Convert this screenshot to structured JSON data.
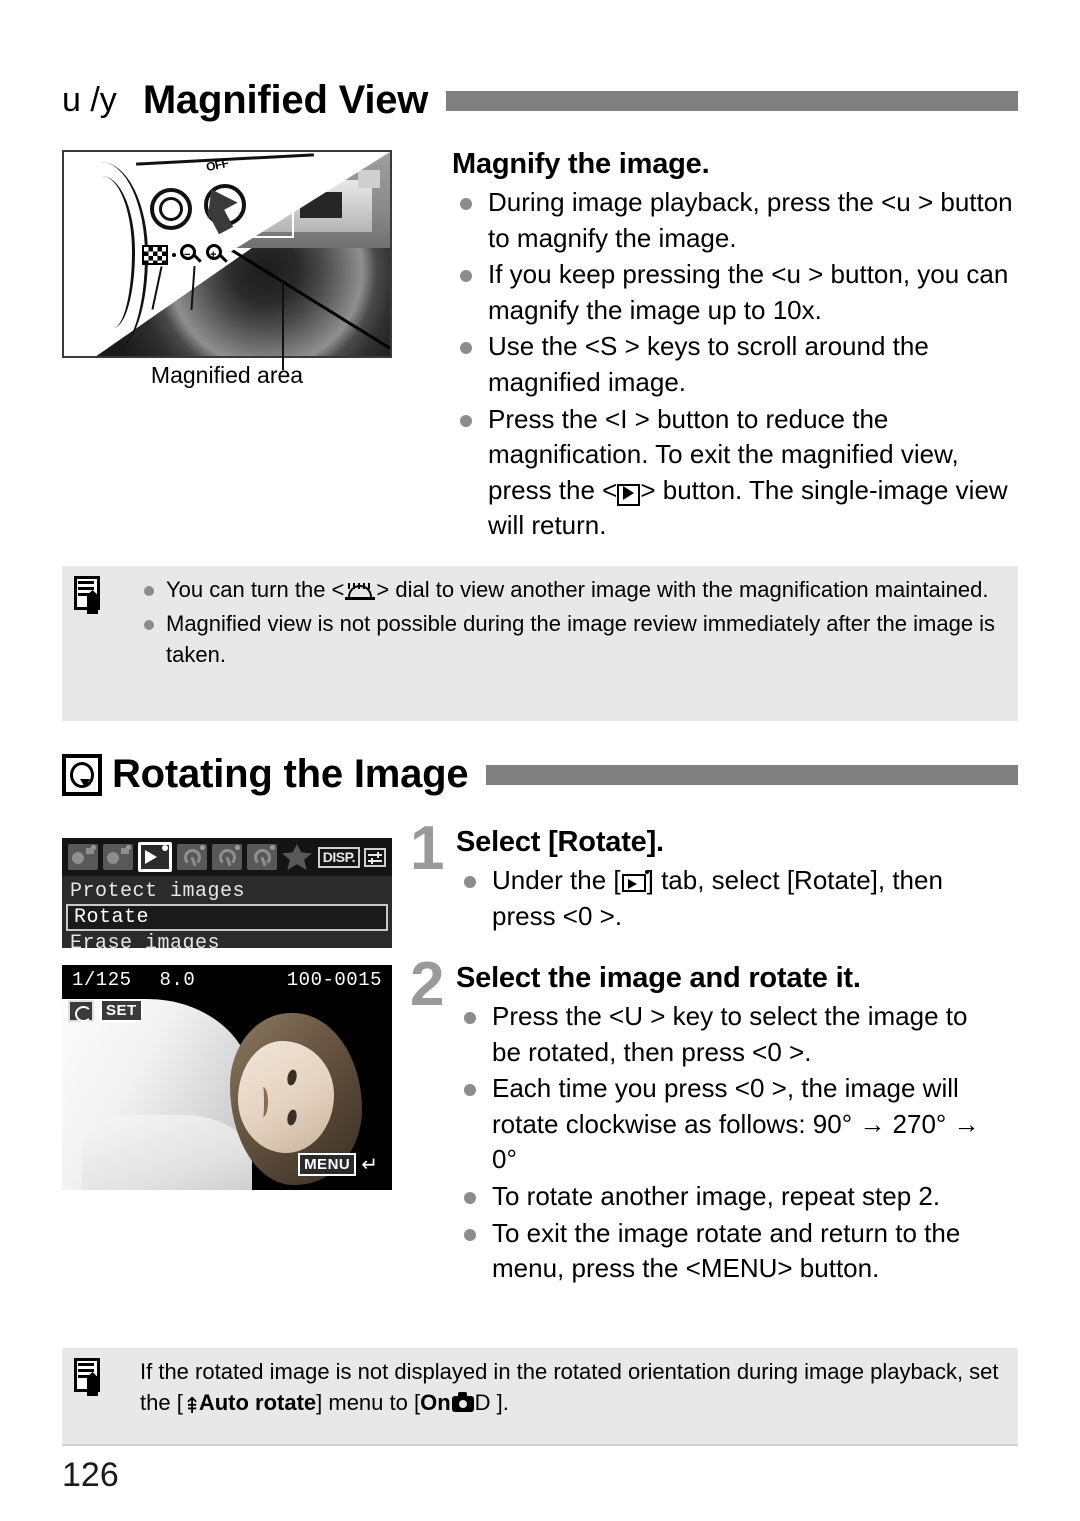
{
  "page": {
    "number": "126"
  },
  "section_magnified": {
    "glyph": "u /y",
    "title": "Magnified View",
    "figure": {
      "caption": "Magnified area",
      "onoff_label": "OFF"
    },
    "subheading": "Magnify the image.",
    "bullets": [
      {
        "parts": [
          {
            "t": "text",
            "v": "During image playback, press the <u > button to magnify the image."
          }
        ]
      },
      {
        "parts": [
          {
            "t": "text",
            "v": "If you keep pressing the <u > button, you can magnify the image up to 10x."
          }
        ]
      },
      {
        "parts": [
          {
            "t": "text",
            "v": "Use the <S > keys to scroll around the magnified image."
          }
        ]
      },
      {
        "parts": [
          {
            "t": "text",
            "v": "Press the <I > button to reduce the magnification. To exit the magnified view, press the <"
          },
          {
            "t": "icon",
            "v": "playback-icon"
          },
          {
            "t": "text",
            "v": "> button. The single-image view will return."
          }
        ]
      }
    ]
  },
  "note_magnified": {
    "icon": "note-icon",
    "bullets": [
      {
        "before": "You can turn the <",
        "icon": "main-dial-icon",
        "after": "> dial to view another image with the magnification maintained."
      },
      {
        "before": "Magnified view is not possible during the image review immediately after the image is taken.",
        "icon": null,
        "after": ""
      }
    ]
  },
  "section_rotating": {
    "icon": "rotate-icon",
    "title": "Rotating the Image",
    "menu_screenshot": {
      "tabs": [
        "shooting-tab-1",
        "shooting-tab-2",
        "playback-tab",
        "setup-tab-1",
        "setup-tab-2",
        "setup-tab-3",
        "my-menu-tab"
      ],
      "active_tab_index": 2,
      "disp_label": "DISP.",
      "settings_icon": "sliders-icon",
      "items": [
        "Protect images",
        "Rotate",
        "Erase images"
      ],
      "selected_item": "Rotate"
    },
    "playback_screenshot": {
      "shutter_speed": "1/125",
      "aperture": "8.0",
      "file_number": "100-0015",
      "rotate_badge_icon": "rotate-icon",
      "set_label": "SET",
      "menu_label": "MENU",
      "return_icon": "return-arrow-icon"
    },
    "steps": [
      {
        "number": "1",
        "title": "Select [Rotate].",
        "bullets": [
          {
            "before": "Under the [",
            "icon": "playback-tab-icon",
            "after": "] tab, select [Rotate], then press <0 >."
          }
        ]
      },
      {
        "number": "2",
        "title": "Select the image and rotate it.",
        "bullets": [
          {
            "text": "Press the <U > key to select the image to be rotated, then press <0 >."
          },
          {
            "text": "Each time you press <0 >, the image will rotate clockwise as follows: 90° → 270° → 0°"
          },
          {
            "text": "To rotate another image, repeat step 2."
          },
          {
            "text": "To exit the image rotate and return to the menu, press the <MENU> button."
          }
        ]
      }
    ]
  },
  "note_rotating": {
    "icon": "note-icon",
    "before": "If the rotated image is not displayed in the rotated orientation during image playback, set the [",
    "tool_icon": "setup-tool-icon",
    "middle_bold": "Auto rotate",
    "after_middle": "] menu to [",
    "on_label": "On",
    "cam_icon": "camera-icon",
    "tail": "D ].",
    "close": ""
  },
  "colors": {
    "header_bar": "#808080",
    "note_background": "#e8e8e8",
    "bullet_dot": "#8c8c8c",
    "step_number": "#9a9a9a"
  }
}
